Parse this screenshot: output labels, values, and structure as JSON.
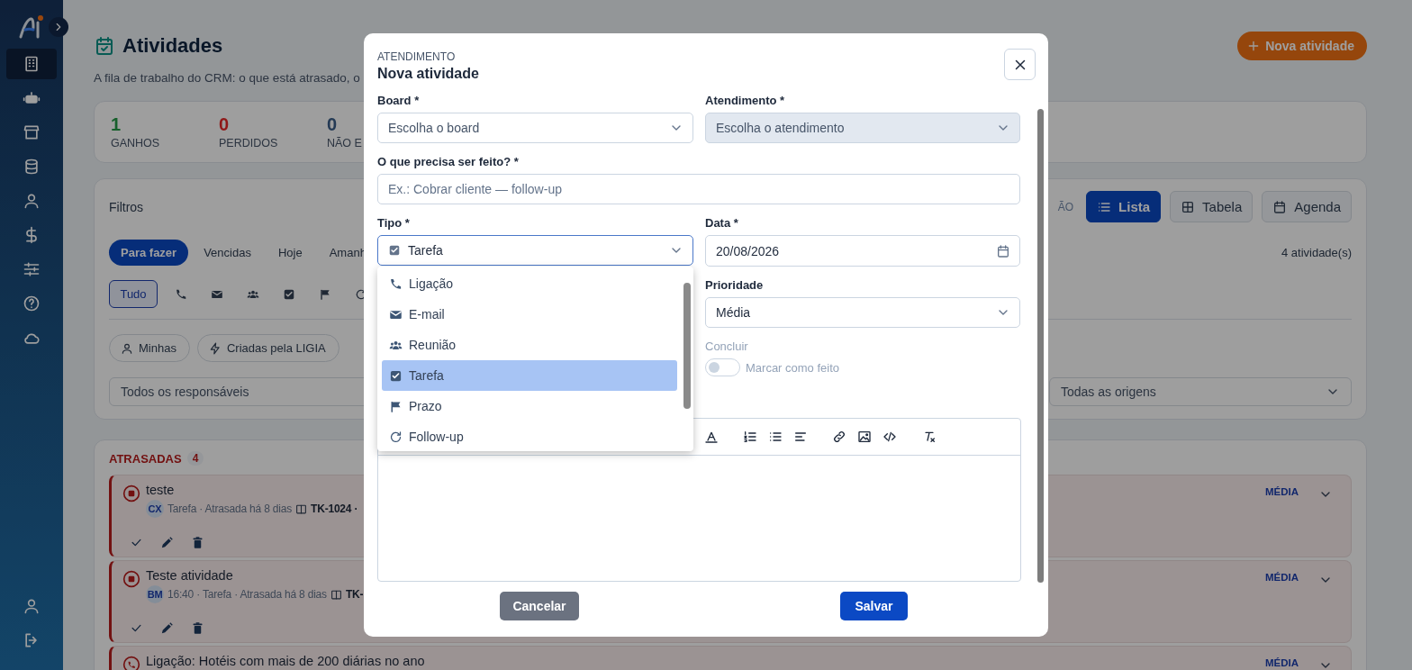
{
  "sidebar": {
    "items": [
      {
        "kind": "building",
        "selected": true
      },
      {
        "kind": "robot",
        "selected": false
      },
      {
        "kind": "store",
        "selected": false
      },
      {
        "kind": "database",
        "selected": false
      },
      {
        "kind": "user",
        "selected": false
      },
      {
        "kind": "dollar",
        "selected": false
      },
      {
        "kind": "sliders",
        "selected": false
      },
      {
        "kind": "help",
        "selected": false
      },
      {
        "kind": "cloud",
        "selected": false
      }
    ],
    "bottom_items": [
      {
        "kind": "user",
        "selected": false
      },
      {
        "kind": "logout",
        "selected": false
      }
    ]
  },
  "page": {
    "title": "Atividades",
    "subtitle": "A fila de trabalho do CRM: o que está atrasado, o",
    "new_button": "Nova atividade"
  },
  "stats": [
    {
      "value": "1",
      "label": "GANHOS",
      "color": "#17602c"
    },
    {
      "value": "0",
      "label": "PERDIDOS",
      "color": "#8f1818"
    },
    {
      "value": "0",
      "label": "NÃO E",
      "color": "#243a55"
    }
  ],
  "filters": {
    "title": "Filtros",
    "view_label": "ÃO",
    "views": [
      {
        "kind": "list",
        "label": "Lista",
        "selected": true
      },
      {
        "kind": "table",
        "label": "Tabela",
        "selected": false
      },
      {
        "kind": "calendar",
        "label": "Agenda",
        "selected": false
      }
    ],
    "quick": [
      {
        "label": "Para fazer",
        "selected": true
      },
      {
        "label": "Vencidas",
        "selected": false
      },
      {
        "label": "Hoje",
        "selected": false
      },
      {
        "label": "Amanh",
        "selected": false
      }
    ],
    "count": "4 atividade(s)",
    "types": [
      {
        "kind": "all",
        "label": "Tudo",
        "selected": true
      },
      {
        "kind": "phone",
        "selected": false
      },
      {
        "kind": "email",
        "selected": false
      },
      {
        "kind": "meeting",
        "selected": false
      },
      {
        "kind": "task",
        "selected": false
      },
      {
        "kind": "deadline",
        "selected": false
      },
      {
        "kind": "followup",
        "selected": false
      }
    ],
    "chips": [
      {
        "kind": "user",
        "label": "Minhas"
      },
      {
        "kind": "bolt",
        "label": "Criadas pela LIGIA"
      }
    ],
    "owner_select": "Todos os responsáveis",
    "origin_select": "Todas as origens"
  },
  "overdue": {
    "title": "ATRASADAS",
    "count": "4",
    "items": [
      {
        "kind": "task",
        "title": "teste",
        "avatar": "CX",
        "meta": "Tarefa · Atrasada há 8 dias",
        "ref": "TK-1024 ·",
        "priority": "MÉDIA"
      },
      {
        "kind": "task",
        "title": "Teste atividade",
        "avatar": "BM",
        "meta": "16:40 · Tarefa · Atrasada há 8 dias",
        "ref": "TK-",
        "priority": "MÉDIA"
      },
      {
        "kind": "call",
        "title": "Ligação: Hotéis com mais de 200 diárias no ano",
        "priority": "MÉDIA"
      }
    ]
  },
  "modal": {
    "eyebrow": "ATENDIMENTO",
    "title": "Nova atividade",
    "board": {
      "label": "Board *",
      "placeholder": "Escolha o board"
    },
    "ticket": {
      "label": "Atendimento *",
      "placeholder": "Escolha o atendimento",
      "disabled": true
    },
    "task": {
      "label": "O que precisa ser feito? *",
      "placeholder": "Ex.: Cobrar cliente — follow-up"
    },
    "type": {
      "label": "Tipo *",
      "value": "Tarefa",
      "kind": "task",
      "expanded": true,
      "options": [
        {
          "kind": "phone",
          "label": "Ligação",
          "selected": false
        },
        {
          "kind": "email",
          "label": "E-mail",
          "selected": false
        },
        {
          "kind": "meeting",
          "label": "Reunião",
          "selected": false
        },
        {
          "kind": "task",
          "label": "Tarefa",
          "selected": true
        },
        {
          "kind": "deadline",
          "label": "Prazo",
          "selected": false
        },
        {
          "kind": "followup",
          "label": "Follow-up",
          "selected": false
        }
      ]
    },
    "date": {
      "label": "Data *",
      "value": "20/08/2026"
    },
    "priority": {
      "label": "Prioridade",
      "value": "Média"
    },
    "done": {
      "label": "Concluir",
      "text": "Marcar como feito",
      "on": false,
      "disabled": true
    },
    "editor_tools": [
      {
        "kind": "highlight"
      },
      {
        "kind": "ordered"
      },
      {
        "kind": "bullets"
      },
      {
        "kind": "align"
      },
      {
        "kind": "link"
      },
      {
        "kind": "image"
      },
      {
        "kind": "code"
      },
      {
        "kind": "clear"
      }
    ],
    "cancel": "Cancelar",
    "save": "Salvar"
  }
}
